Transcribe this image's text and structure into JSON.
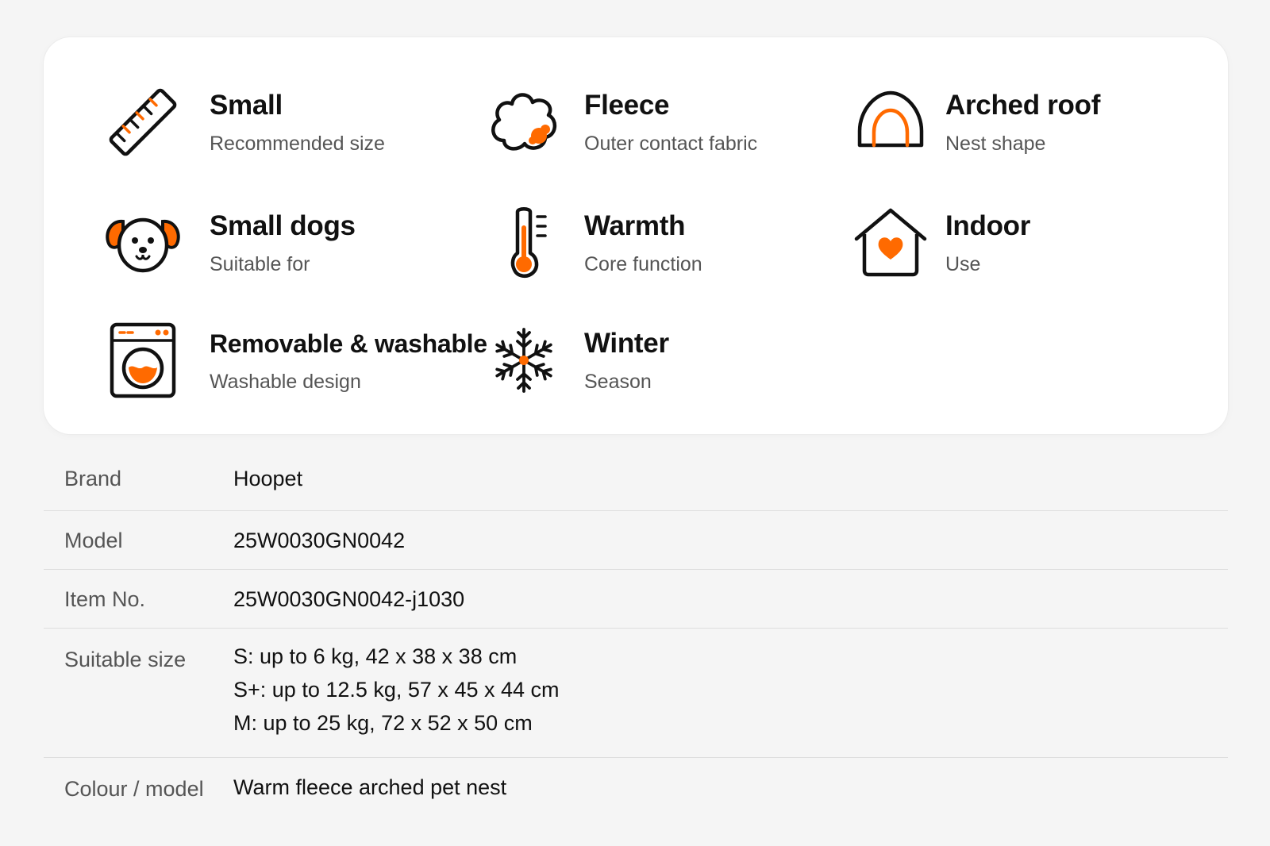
{
  "features": [
    {
      "title": "Small",
      "subtitle": "Recommended size",
      "icon": "ruler-icon"
    },
    {
      "title": "Fleece",
      "subtitle": "Outer contact fabric",
      "icon": "fleece-cloud-icon"
    },
    {
      "title": "Arched roof",
      "subtitle": "Nest shape",
      "icon": "arched-roof-icon"
    },
    {
      "title": "Small dogs",
      "subtitle": "Suitable for",
      "icon": "dog-face-icon"
    },
    {
      "title": "Warmth",
      "subtitle": "Core function",
      "icon": "thermometer-icon"
    },
    {
      "title": "Indoor",
      "subtitle": "Use",
      "icon": "house-heart-icon"
    },
    {
      "title": "Removable & washable",
      "subtitle": "Washable design",
      "icon": "washing-machine-icon"
    },
    {
      "title": "Winter",
      "subtitle": "Season",
      "icon": "snowflake-icon"
    }
  ],
  "specs": {
    "brand": {
      "label": "Brand",
      "value": "Hoopet"
    },
    "model": {
      "label": "Model",
      "value": "25W0030GN0042"
    },
    "item_no": {
      "label": "Item No.",
      "value": "25W0030GN0042-j1030"
    },
    "suitable_size": {
      "label": "Suitable size",
      "lines": [
        "S: up to 6 kg, 42 x 38 x 38 cm",
        "S+: up to 12.5 kg, 57 x 45 x 44 cm",
        "M: up to 25 kg, 72 x 52 x 50 cm"
      ]
    },
    "colour_model": {
      "label": "Colour / model",
      "value": "Warm fleece arched pet nest"
    }
  },
  "colors": {
    "accent": "#ff6a00",
    "icon_stroke": "#111111",
    "background": "#f5f5f5",
    "card": "#ffffff",
    "label_text": "#555555",
    "divider": "#dedede"
  }
}
